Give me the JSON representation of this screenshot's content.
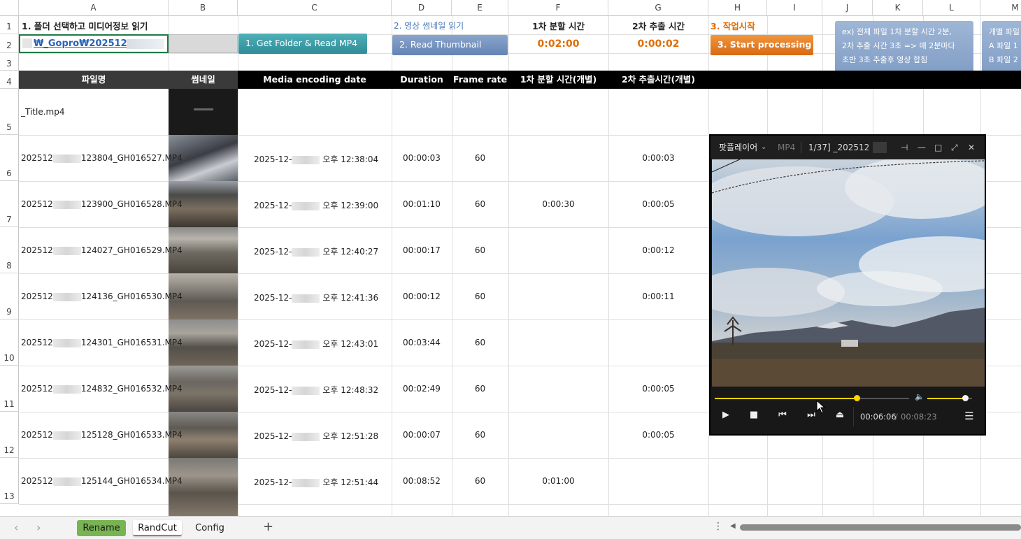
{
  "columns": [
    "A",
    "B",
    "C",
    "D",
    "E",
    "F",
    "G",
    "H",
    "I",
    "J",
    "K",
    "L",
    "M"
  ],
  "rows": [
    "1",
    "2",
    "3",
    "4",
    "5",
    "6",
    "7",
    "8",
    "9",
    "10",
    "11",
    "12",
    "13"
  ],
  "row1": {
    "a1": "1. 폴더 선택하고 미디어정보 읽기",
    "d1": "2. 영상 썸네일 읽기",
    "f1": "1차 분할 시간",
    "g1": "2차 추출 시간",
    "h1": "3. 작업시작"
  },
  "row2": {
    "a2": "₩_Gopro₩202512",
    "f2": "0:02:00",
    "g2": "0:00:02"
  },
  "buttons": {
    "get_folder": "1. Get Folder & Read MP4",
    "read_thumb": "2. Read  Thumbnail",
    "start": "3. Start processing"
  },
  "notes": {
    "example_lines": [
      "ex) 전체 파일 1차 분할 시간 2분,",
      "2차 추출 시간 3초 => 매 2분마다",
      "초반 3초 추출후 영상 합침"
    ],
    "individual_lines": [
      "개별 파일",
      "A 파일 1",
      "B 파일 2"
    ]
  },
  "header": {
    "filename": "파일명",
    "thumbnail": "썸네일",
    "encoding_date": "Media encoding date",
    "duration": "Duration",
    "frame_rate": "Frame rate",
    "split_time": "1차 분할 시간(개별)",
    "extract_time": "2차 추출시간(개별)"
  },
  "files": [
    {
      "name": "_Title.mp4",
      "date_prefix": "",
      "time": "",
      "duration": "",
      "fps": "",
      "split": "",
      "extract": ""
    },
    {
      "name_pre": "202512",
      "name": "123804_GH016527.MP4",
      "date_prefix": "2025-12-",
      "time": "오후 12:38:04",
      "duration": "00:00:03",
      "fps": "60",
      "split": "",
      "extract": "0:00:03"
    },
    {
      "name_pre": "202512",
      "name": "123900_GH016528.MP4",
      "date_prefix": "2025-12-",
      "time": "오후 12:39:00",
      "duration": "00:01:10",
      "fps": "60",
      "split": "0:00:30",
      "extract": "0:00:05"
    },
    {
      "name_pre": "202512",
      "name": "124027_GH016529.MP4",
      "date_prefix": "2025-12-",
      "time": "오후 12:40:27",
      "duration": "00:00:17",
      "fps": "60",
      "split": "",
      "extract": "0:00:12"
    },
    {
      "name_pre": "202512",
      "name": "124136_GH016530.MP4",
      "date_prefix": "2025-12-",
      "time": "오후 12:41:36",
      "duration": "00:00:12",
      "fps": "60",
      "split": "",
      "extract": "0:00:11"
    },
    {
      "name_pre": "202512",
      "name": "124301_GH016531.MP4",
      "date_prefix": "2025-12-",
      "time": "오후 12:43:01",
      "duration": "00:03:44",
      "fps": "60",
      "split": "",
      "extract": ""
    },
    {
      "name_pre": "202512",
      "name": "124832_GH016532.MP4",
      "date_prefix": "2025-12-",
      "time": "오후 12:48:32",
      "duration": "00:02:49",
      "fps": "60",
      "split": "",
      "extract": "0:00:05"
    },
    {
      "name_pre": "202512",
      "name": "125128_GH016533.MP4",
      "date_prefix": "2025-12-",
      "time": "오후 12:51:28",
      "duration": "00:00:07",
      "fps": "60",
      "split": "",
      "extract": "0:00:05"
    },
    {
      "name_pre": "202512",
      "name": "125144_GH016534.MP4",
      "date_prefix": "2025-12-",
      "time": "오후 12:51:44",
      "duration": "00:08:52",
      "fps": "60",
      "split": "0:01:00",
      "extract": ""
    }
  ],
  "player": {
    "app_name": "팟플레이어",
    "format": "MP4",
    "title": "1/37] _202512",
    "current_time": "00:06:06",
    "separator": "/",
    "total_time": "00:08:23",
    "progress": 0.73,
    "volume": 0.85
  },
  "tabs": {
    "rename": "Rename",
    "randcut": "RandCut",
    "config": "Config",
    "add": "+"
  },
  "colors": {
    "accent_yellow": "#ffd400",
    "button_teal": "#3a9aa5",
    "button_blue": "#6f8fbd",
    "button_orange": "#e67a1f",
    "time_orange": "#e06d00",
    "tab_green": "#78b452"
  }
}
